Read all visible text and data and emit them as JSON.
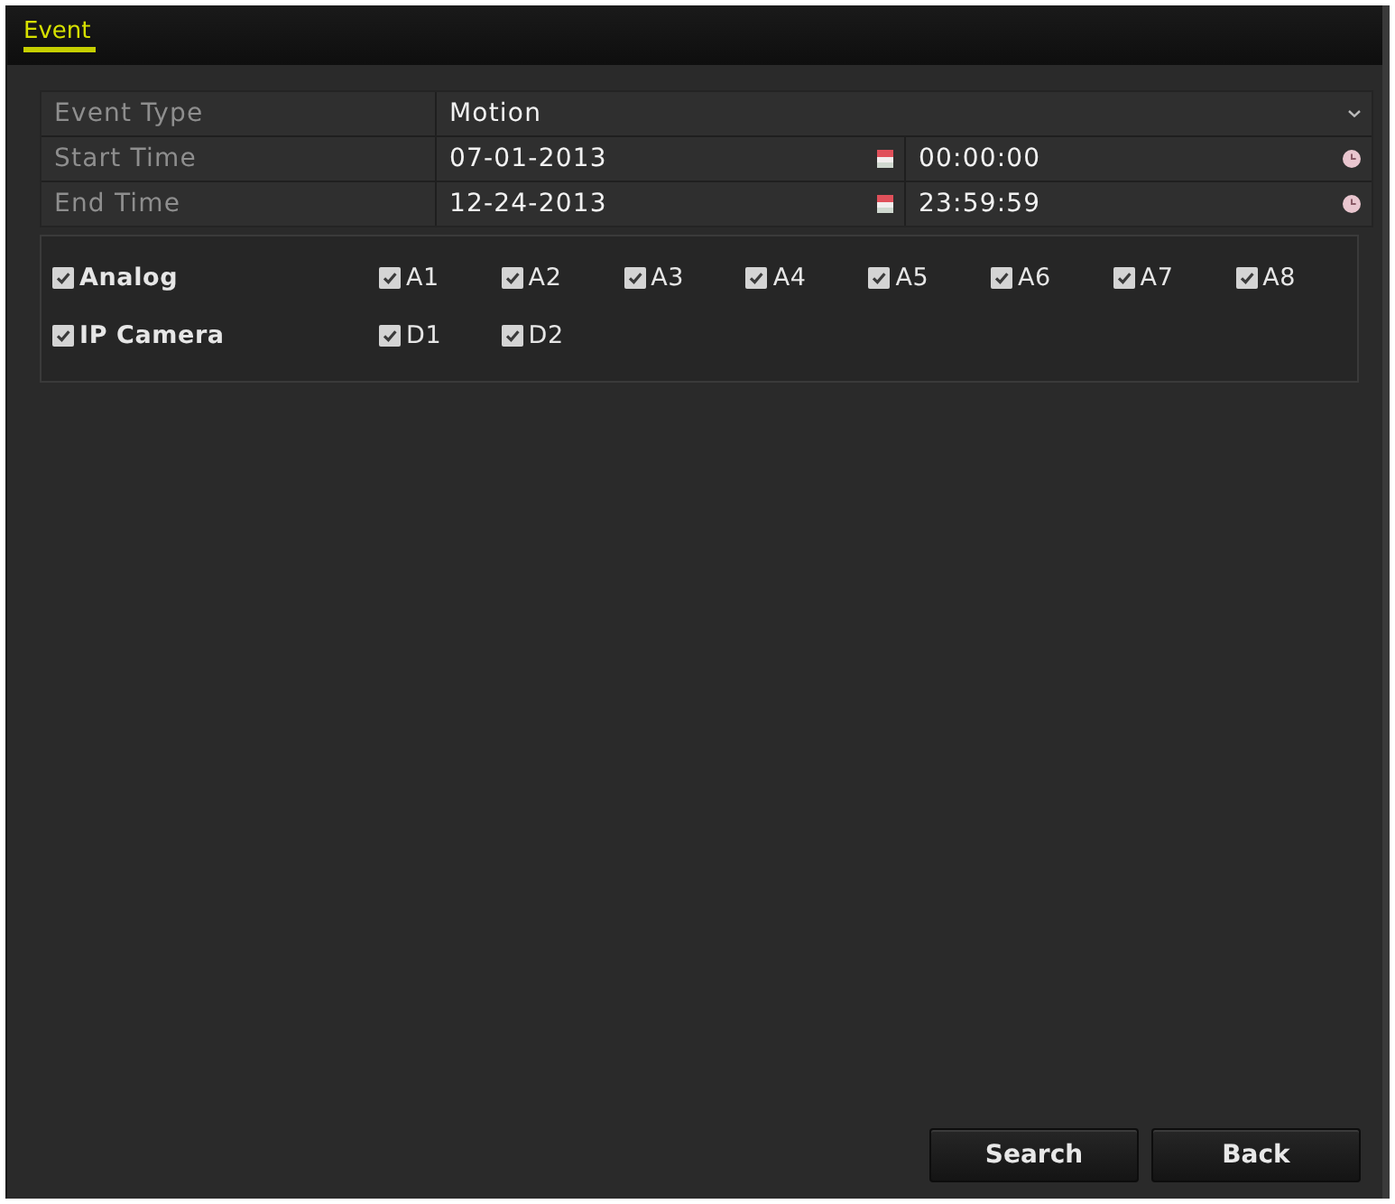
{
  "window": {
    "title": "Event"
  },
  "form": {
    "rows": [
      {
        "kind": "select",
        "label": "Event Type",
        "value": "Motion"
      },
      {
        "kind": "datetime",
        "label": "Start Time",
        "date": "07-01-2013",
        "time": "00:00:00"
      },
      {
        "kind": "datetime",
        "label": "End Time",
        "date": "12-24-2013",
        "time": "23:59:59"
      }
    ]
  },
  "channels": {
    "groups": [
      {
        "label": "Analog",
        "checked": true,
        "items": [
          {
            "label": "A1",
            "checked": true
          },
          {
            "label": "A2",
            "checked": true
          },
          {
            "label": "A3",
            "checked": true
          },
          {
            "label": "A4",
            "checked": true
          },
          {
            "label": "A5",
            "checked": true
          },
          {
            "label": "A6",
            "checked": true
          },
          {
            "label": "A7",
            "checked": true
          },
          {
            "label": "A8",
            "checked": true
          }
        ]
      },
      {
        "label": "IP Camera",
        "checked": true,
        "items": [
          {
            "label": "D1",
            "checked": true
          },
          {
            "label": "D2",
            "checked": true
          }
        ]
      }
    ]
  },
  "buttons": [
    "Search",
    "Back"
  ]
}
